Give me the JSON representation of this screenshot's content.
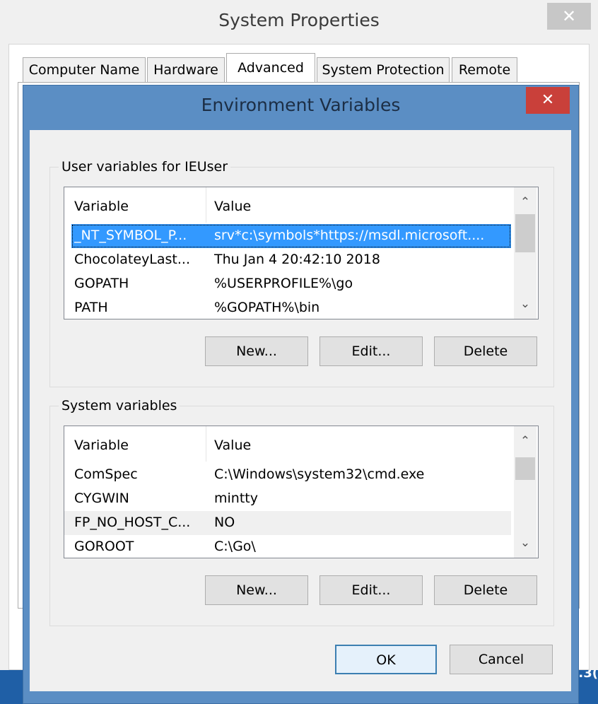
{
  "system_properties": {
    "title": "System Properties",
    "close_glyph": "✕",
    "tabs": [
      {
        "label": "Computer Name"
      },
      {
        "label": "Hardware"
      },
      {
        "label": "Advanced"
      },
      {
        "label": "System Protection"
      },
      {
        "label": "Remote"
      }
    ],
    "active_tab": "Advanced"
  },
  "env_dialog": {
    "title": "Environment Variables",
    "close_glyph": "✕",
    "user_group": {
      "label": "User variables for IEUser",
      "columns": [
        "Variable",
        "Value"
      ],
      "rows": [
        {
          "variable": "_NT_SYMBOL_P...",
          "value": "srv*c:\\symbols*https://msdl.microsoft....",
          "selected": true
        },
        {
          "variable": "ChocolateyLast...",
          "value": "Thu Jan  4 20:42:10 2018"
        },
        {
          "variable": "GOPATH",
          "value": "%USERPROFILE%\\go"
        },
        {
          "variable": "PATH",
          "value": "%GOPATH%\\bin"
        }
      ],
      "buttons": {
        "new": "New...",
        "edit": "Edit...",
        "delete": "Delete"
      }
    },
    "system_group": {
      "label": "System variables",
      "columns": [
        "Variable",
        "Value"
      ],
      "rows": [
        {
          "variable": "ComSpec",
          "value": "C:\\Windows\\system32\\cmd.exe"
        },
        {
          "variable": "CYGWIN",
          "value": "mintty"
        },
        {
          "variable": "FP_NO_HOST_C...",
          "value": "NO"
        },
        {
          "variable": "GOROOT",
          "value": "C:\\Go\\"
        }
      ],
      "buttons": {
        "new": "New...",
        "edit": "Edit...",
        "delete": "Delete"
      }
    },
    "ok_label": "OK",
    "cancel_label": "Cancel"
  },
  "scroll": {
    "up_glyph": "⌃",
    "down_glyph": "⌄"
  },
  "desktop": {
    "fragment": ".3("
  }
}
